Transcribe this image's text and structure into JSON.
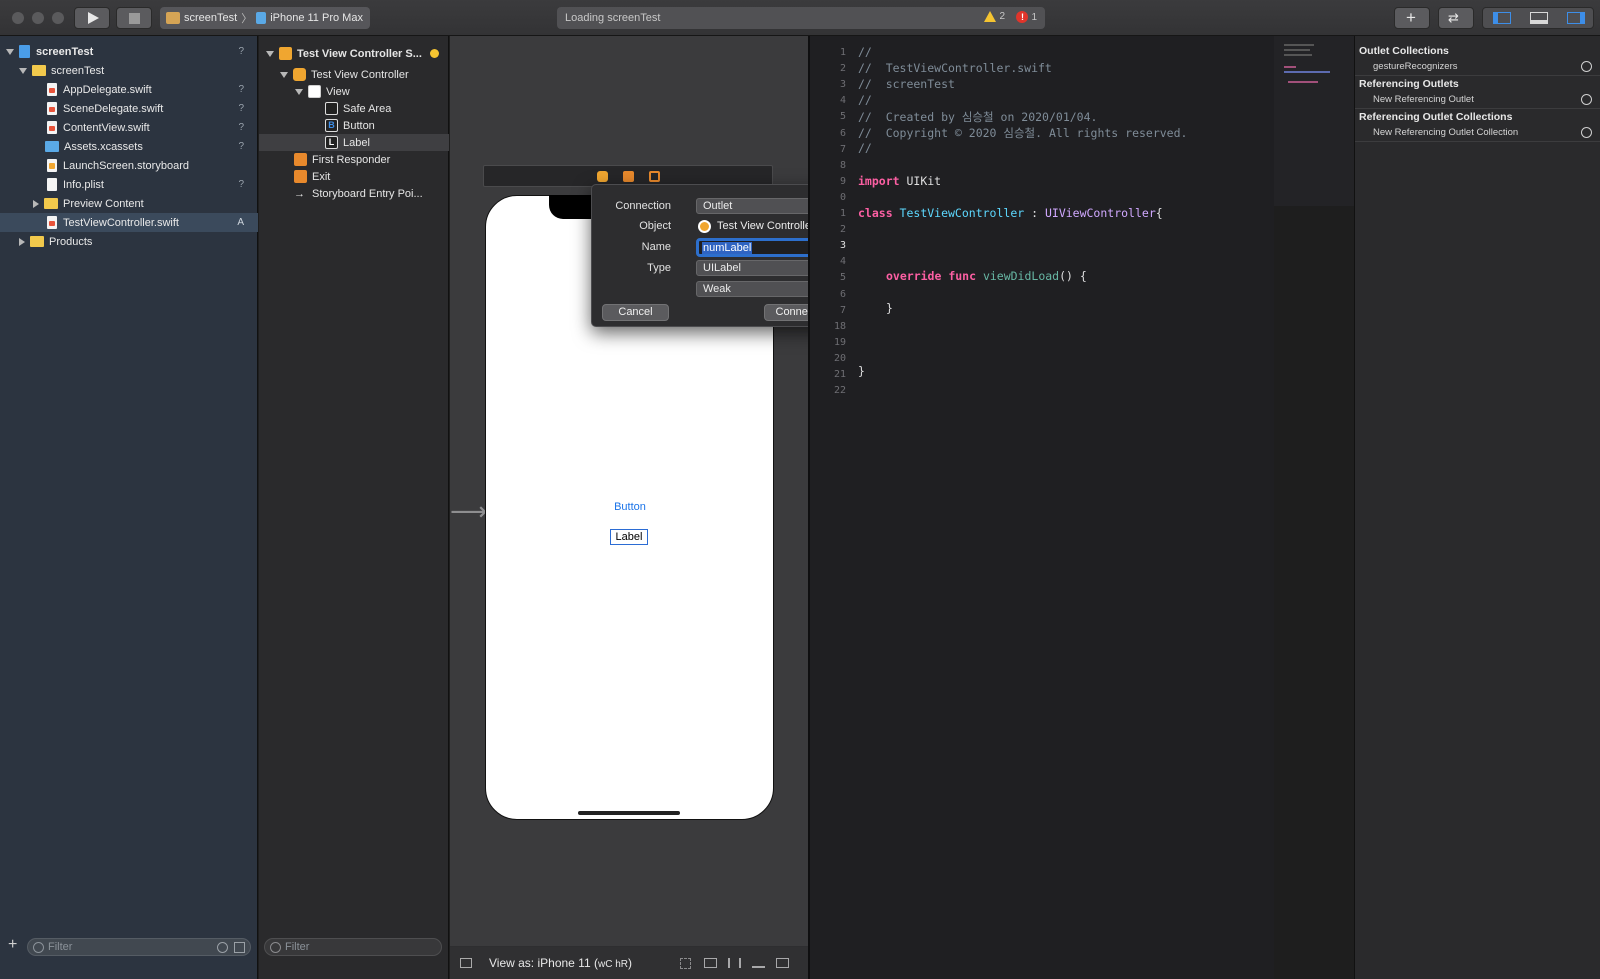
{
  "toolbar": {
    "scheme": "screenTest",
    "device": "iPhone 11 Pro Max",
    "activity": "Loading screenTest",
    "warnings": "2",
    "errors": "1"
  },
  "navigator": {
    "items": [
      {
        "label": "screenTest",
        "badge": "?"
      },
      {
        "label": "screenTest",
        "badge": ""
      },
      {
        "label": "AppDelegate.swift",
        "badge": "?"
      },
      {
        "label": "SceneDelegate.swift",
        "badge": "?"
      },
      {
        "label": "ContentView.swift",
        "badge": "?"
      },
      {
        "label": "Assets.xcassets",
        "badge": "?"
      },
      {
        "label": "LaunchScreen.storyboard",
        "badge": ""
      },
      {
        "label": "Info.plist",
        "badge": "?"
      },
      {
        "label": "Preview Content",
        "badge": ""
      },
      {
        "label": "TestViewController.swift",
        "badge": "A"
      },
      {
        "label": "Products",
        "badge": ""
      }
    ],
    "filter_placeholder": "Filter"
  },
  "outline": {
    "items": [
      {
        "label": "Test View Controller S..."
      },
      {
        "label": "Test View Controller"
      },
      {
        "label": "View"
      },
      {
        "label": "Safe Area"
      },
      {
        "label": "Button"
      },
      {
        "label": "Label"
      },
      {
        "label": "First Responder"
      },
      {
        "label": "Exit"
      },
      {
        "label": "Storyboard Entry Poi..."
      }
    ],
    "filter_placeholder": "Filter"
  },
  "canvas": {
    "button_text": "Button",
    "label_text": "Label",
    "view_as": "View as: iPhone 11 (",
    "size_class": "wC hR",
    "view_as_end": ")"
  },
  "popover": {
    "connection_label": "Connection",
    "connection_value": "Outlet",
    "object_label": "Object",
    "object_value": "Test View Controller",
    "name_label": "Name",
    "name_value": "numLabel",
    "type_label": "Type",
    "type_value": "UILabel",
    "storage_value": "Weak",
    "cancel": "Cancel",
    "connect": "Connect"
  },
  "editor": {
    "line_numbers": [
      "1",
      "2",
      "3",
      "4",
      "5",
      "6",
      "7",
      "8",
      "9",
      "0",
      "1",
      "2",
      "3",
      "4",
      "5",
      "6",
      "7",
      "18",
      "19",
      "20",
      "21",
      "22"
    ],
    "lines": {
      "l1": "//",
      "l2": "//  TestViewController.swift",
      "l3": "//  screenTest",
      "l4": "//",
      "l5": "//  Created by 심승철 on 2020/01/04.",
      "l6": "//  Copyright © 2020 심승철. All rights reserved.",
      "l7": "//",
      "import_kw": "import",
      "import_mod": " UIKit",
      "class_kw": "class",
      "class_name": " TestViewController",
      "colon": " : ",
      "super_name": "UIViewController",
      "brace_open": "{",
      "override_kw": "override",
      "func_kw": " func",
      "func_name": " viewDidLoad",
      "func_rest": "() {",
      "inner_close": "}",
      "outer_close": "}"
    }
  },
  "inspector": {
    "outlet_collections": "Outlet Collections",
    "gesture": "gestureRecognizers",
    "referencing_outlets": "Referencing Outlets",
    "new_ref_outlet": "New Referencing Outlet",
    "referencing_outlet_collections": "Referencing Outlet Collections",
    "new_ref_outlet_collection": "New Referencing Outlet Collection"
  }
}
